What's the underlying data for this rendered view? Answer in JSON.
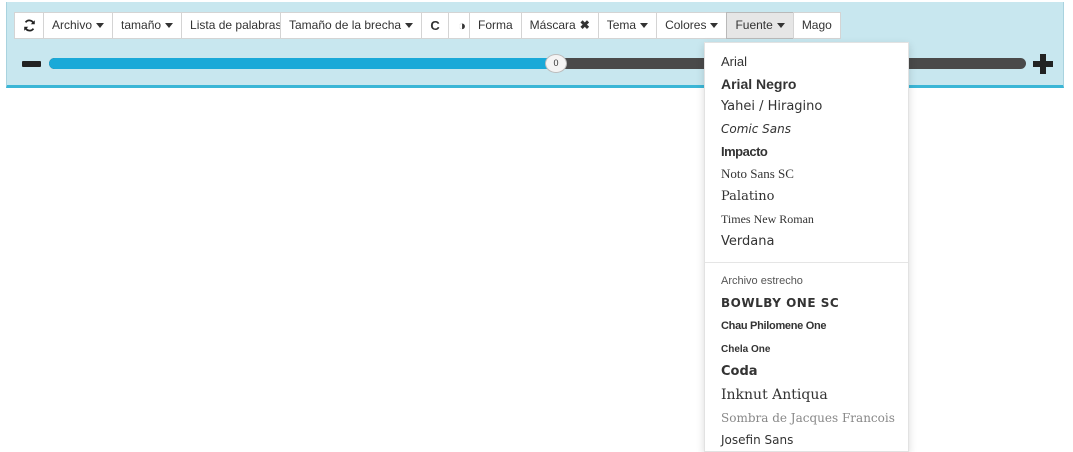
{
  "toolbar": {
    "group1": [
      {
        "label": "",
        "icon": "refresh-icon",
        "caret": false
      },
      {
        "label": "Archivo",
        "caret": true
      },
      {
        "label": "tamaño",
        "caret": true
      },
      {
        "label": "Lista de palabras",
        "caret": false
      }
    ],
    "group2": [
      {
        "label": "Tamaño de la brecha",
        "caret": true
      },
      {
        "label": "C",
        "icon": "redo-icon",
        "caret": false
      },
      {
        "label": "◑",
        "icon": "contrast-icon",
        "caret": false
      }
    ],
    "group3": [
      {
        "label": "Forma",
        "caret": false
      },
      {
        "label": "Máscara",
        "caret": false,
        "x": "✖"
      },
      {
        "label": "Tema",
        "caret": true
      },
      {
        "label": "Colores",
        "caret": true
      },
      {
        "label": "Fuente",
        "caret": true,
        "active": true
      },
      {
        "label": "Mago",
        "caret": false
      }
    ]
  },
  "slider": {
    "value": "0",
    "fill_fraction": 0.515,
    "track_color": "#4a4a4a",
    "fill_color": "#1aa9d8"
  },
  "font_menu": {
    "items_top": [
      "Arial",
      "Arial Negro",
      "Yahei / Hiragino",
      "Comic Sans",
      "Impacto",
      "Noto Sans SC",
      "Palatino",
      "Times New Roman",
      "Verdana"
    ],
    "section_header": "Archivo estrecho",
    "items_bottom": [
      "BOWLBY ONE SC",
      "Chau Philomene One",
      "Chela One",
      "Coda",
      "Inknut Antiqua",
      "Sombra de Jacques Francois",
      "Josefin Sans"
    ]
  }
}
